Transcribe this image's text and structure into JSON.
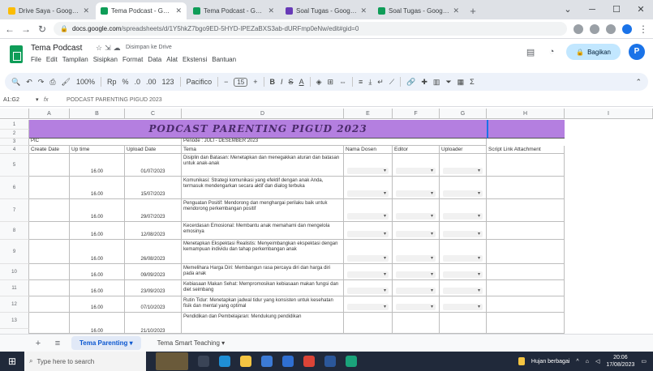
{
  "browser": {
    "tabs": [
      {
        "label": "Drive Saya - Google Drive",
        "color": "#fbbc04"
      },
      {
        "label": "Tema Podcast - Google Sprea",
        "color": "#0f9d58",
        "active": true
      },
      {
        "label": "Tema Podcast - Google Sprea",
        "color": "#0f9d58"
      },
      {
        "label": "Soal Tugas - Google Form",
        "color": "#673ab7"
      },
      {
        "label": "Soal Tugas - Google Sprea",
        "color": "#0f9d58"
      }
    ],
    "new_tab": "+",
    "url_host": "docs.google.com",
    "url_rest": "/spreadsheets/d/1Y5hkZ7bgo9ED-5HYD-IPEZaBXS3ab-dURFmp0eNw/edit#gid=0"
  },
  "doc": {
    "title": "Tema Podcast",
    "save_status": "Disimpan ke Drive",
    "menu": [
      "File",
      "Edit",
      "Tampilan",
      "Sisipkan",
      "Format",
      "Data",
      "Alat",
      "Ekstensi",
      "Bantuan"
    ],
    "share_label": "Bagikan",
    "avatar_letter": "P"
  },
  "toolbar": {
    "zoom": "100%",
    "font": "Pacifico",
    "font_size": "15"
  },
  "formula_bar": {
    "cell_ref": "A1:G2",
    "value": "PODCAST PARENTING PIGUD 2023"
  },
  "columns": [
    "A",
    "B",
    "C",
    "D",
    "E",
    "F",
    "G",
    "H",
    "I"
  ],
  "sheet": {
    "banner_title": "PODCAST PARENTING PIGUD 2023",
    "pic_label": "PIC",
    "period_label": "Periode : JULI - DESEMBER 2023",
    "headers": [
      "Create Date",
      "Up time",
      "Upload Date",
      "Tema",
      "Nama Dosen",
      "Editor",
      "Uploader",
      "Script Link Attachment"
    ],
    "row_numbers": [
      "1",
      "2",
      "3",
      "4",
      "5",
      "6",
      "7",
      "8",
      "9",
      "10",
      "11",
      "12",
      "13",
      "14"
    ],
    "rows": [
      {
        "time": "16.00",
        "date": "01/07/2023",
        "tema": "Disiplin dan Batasan: Menetapkan dan menegakkan aturan dan batasan untuk anak-anak"
      },
      {
        "time": "16.00",
        "date": "15/07/2023",
        "tema": "Komunikasi: Strategi komunikasi yang efektif dengan anak Anda, termasuk mendengarkan secara aktif dan dialog terbuka"
      },
      {
        "time": "16.00",
        "date": "29/07/2023",
        "tema": "Penguatan Positif: Mendorong dan menghargai perilaku baik untuk mendorong perkembangan positif"
      },
      {
        "time": "16.00",
        "date": "12/08/2023",
        "tema": "Kecerdasan Emosional: Membantu anak memahami dan mengelola emosinya"
      },
      {
        "time": "16.00",
        "date": "26/08/2023",
        "tema": "Menetapkan Ekspektasi Realistis: Menyeimbangkan ekspektasi dengan kemampuan individu dan tahap perkembangan anak"
      },
      {
        "time": "16.00",
        "date": "09/09/2023",
        "tema": "Memelihara Harga Diri: Membangun rasa percaya diri dan harga diri pada anak"
      },
      {
        "time": "16.00",
        "date": "23/09/2023",
        "tema": "Kebiasaan Makan Sehat: Mempromosikan kebiasaan makan fungsi dan diet seimbang"
      },
      {
        "time": "16.00",
        "date": "07/10/2023",
        "tema": "Rutin Tidur: Menetapkan jadwal tidur yang konsisten untuk kesehatan fisik dan mental yang optimal"
      },
      {
        "time": "16.00",
        "date": "21/10/2023",
        "tema": "Pendidikan dan Pembelajaran: Mendukung pendidikan"
      }
    ]
  },
  "sheet_tabs": [
    "Tema Parenting",
    "Tema Smart Teaching"
  ],
  "taskbar": {
    "search_placeholder": "Type here to search",
    "weather": "Hujan berbagai",
    "time": "20:06",
    "date": "17/08/2023"
  }
}
